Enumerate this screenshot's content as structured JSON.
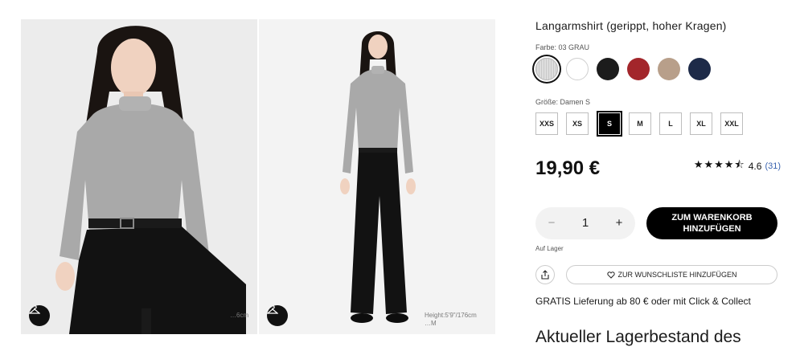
{
  "gallery": {
    "image1_height_text": "…6cm",
    "image2_height_text": "Height:5'9\"/176cm",
    "image2_height_text2": "…M"
  },
  "product": {
    "title": "Langarmshirt (gerippt, hoher Kragen)",
    "color_label": "Farbe: 03 GRAU",
    "colors": [
      {
        "name": "grau",
        "hex": "#d4d4d4",
        "selected": true
      },
      {
        "name": "weiss",
        "hex": "#ffffff",
        "selected": false
      },
      {
        "name": "schwarz",
        "hex": "#1c1c1c",
        "selected": false
      },
      {
        "name": "rot",
        "hex": "#a3262b",
        "selected": false
      },
      {
        "name": "beige",
        "hex": "#b89f8a",
        "selected": false
      },
      {
        "name": "navy",
        "hex": "#1d2a48",
        "selected": false
      }
    ],
    "size_label": "Größe: Damen S",
    "sizes": [
      "XXS",
      "XS",
      "S",
      "M",
      "L",
      "XL",
      "XXL"
    ],
    "selected_size": "S",
    "price": "19,90 €",
    "rating": {
      "stars": "★★★★⯪",
      "value": "4.6",
      "count": "(31)",
      "score": 4.6
    },
    "quantity": {
      "minus": "−",
      "value": "1",
      "plus": "+"
    },
    "add_to_cart": "ZUM WARENKORB HINZUFÜGEN",
    "stock_status": "Auf Lager",
    "wishlist": "ZUR WUNSCHLISTE HINZUFÜGEN",
    "delivery": "GRATIS Lieferung ab 80 € oder mit Click & Collect",
    "stock_heading": "Aktueller Lagerbestand des"
  }
}
